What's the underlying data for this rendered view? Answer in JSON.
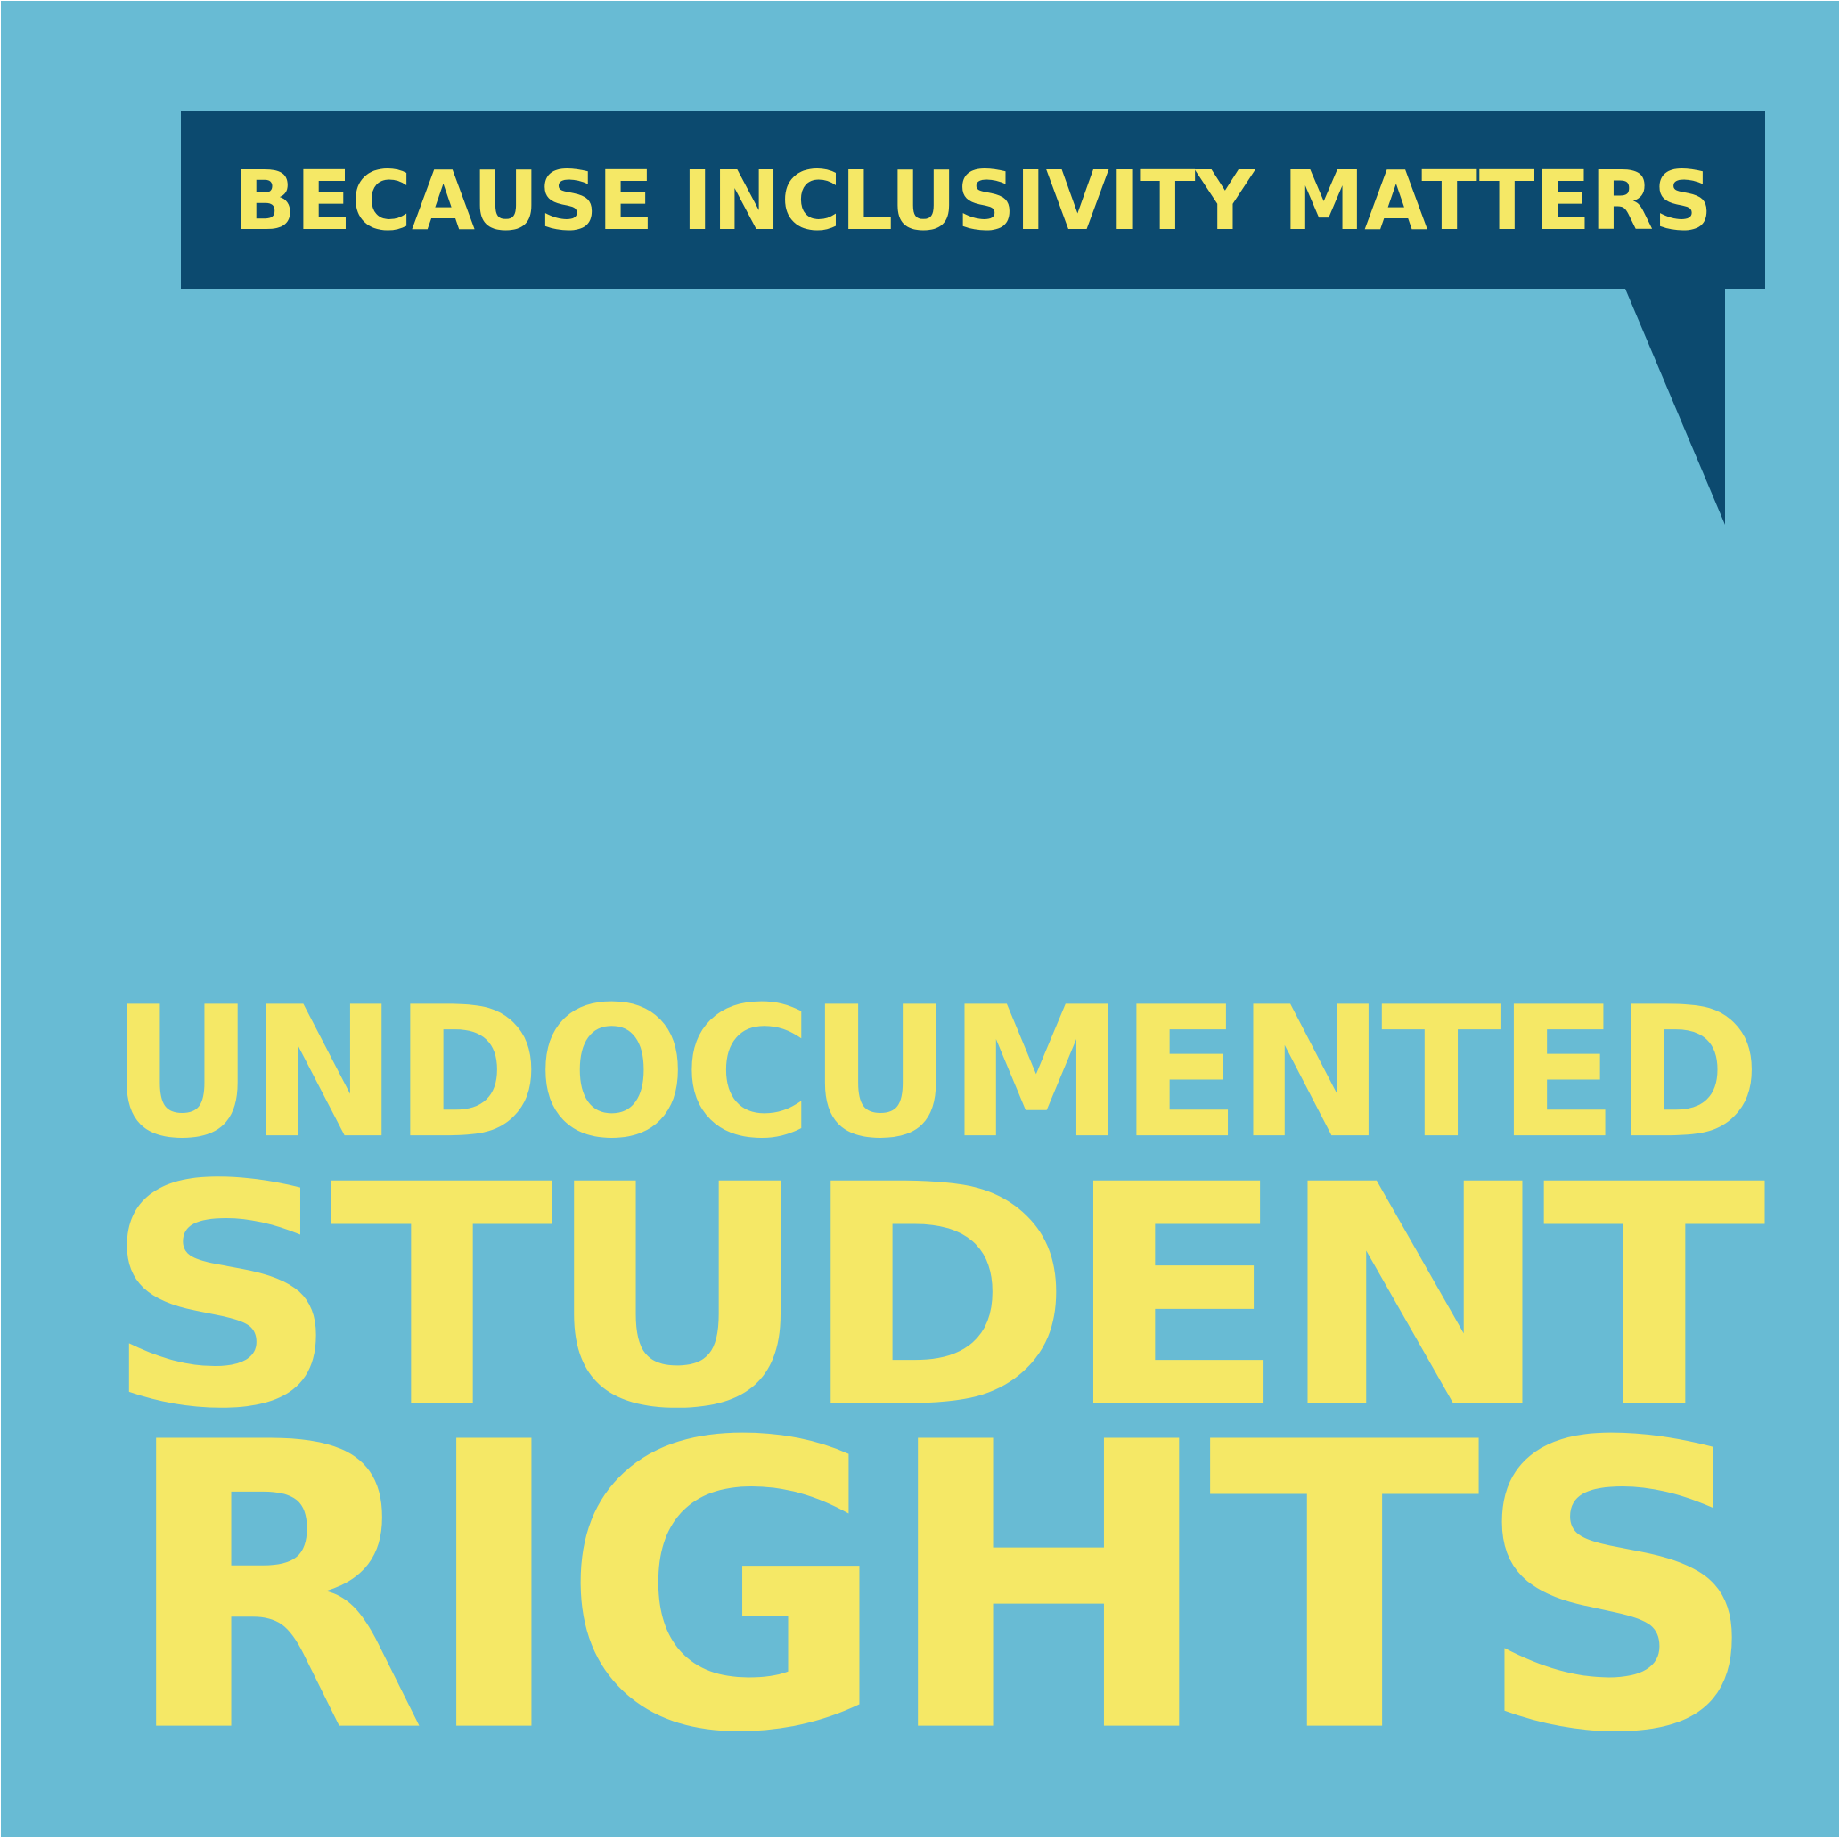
{
  "poster": {
    "background_color": "#68bbd4",
    "text_color": "#f5e866",
    "bubble_color": "#0c4a6f",
    "tagline": "BECAUSE INCLUSIVITY MATTERS",
    "headline": {
      "line1": "UNDOCUMENTED",
      "line2": "STUDENT",
      "line3": "RIGHTS"
    }
  }
}
